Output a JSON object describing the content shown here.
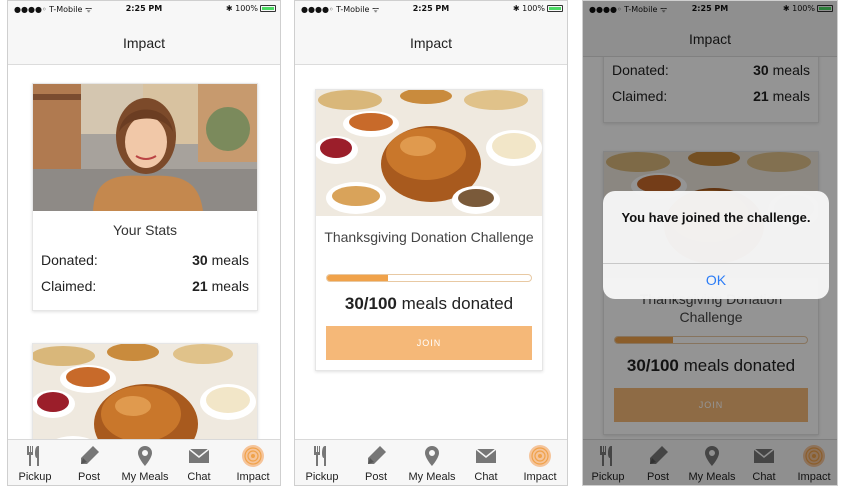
{
  "status": {
    "carrier": "●●●●◦ T-Mobile ᯤ",
    "time": "2:25 PM",
    "battery": "✱ 100%"
  },
  "nav": {
    "title": "Impact"
  },
  "stats": {
    "title": "Your Stats",
    "donated_label": "Donated:",
    "donated_value": "30",
    "claimed_label": "Claimed:",
    "claimed_value": "21",
    "unit": "meals"
  },
  "challenge": {
    "title": "Thanksgiving Donation Challenge",
    "progress_fraction": 0.3,
    "donated_count": "30/100",
    "donated_suffix": "meals donated",
    "join_label": "JOIN"
  },
  "alert": {
    "message": "You have joined the challenge.",
    "ok_label": "OK"
  },
  "tabs": [
    {
      "label": "Pickup",
      "icon": "fork-knife-icon"
    },
    {
      "label": "Post",
      "icon": "pencil-icon"
    },
    {
      "label": "My Meals",
      "icon": "location-pin-icon"
    },
    {
      "label": "Chat",
      "icon": "envelope-icon"
    },
    {
      "label": "Impact",
      "icon": "impact-target-icon"
    }
  ],
  "colors": {
    "accent": "#f0a24a",
    "join_button": "#f5b878",
    "link_blue": "#2b7cf6",
    "bar_bg": "#f7f7f7"
  }
}
